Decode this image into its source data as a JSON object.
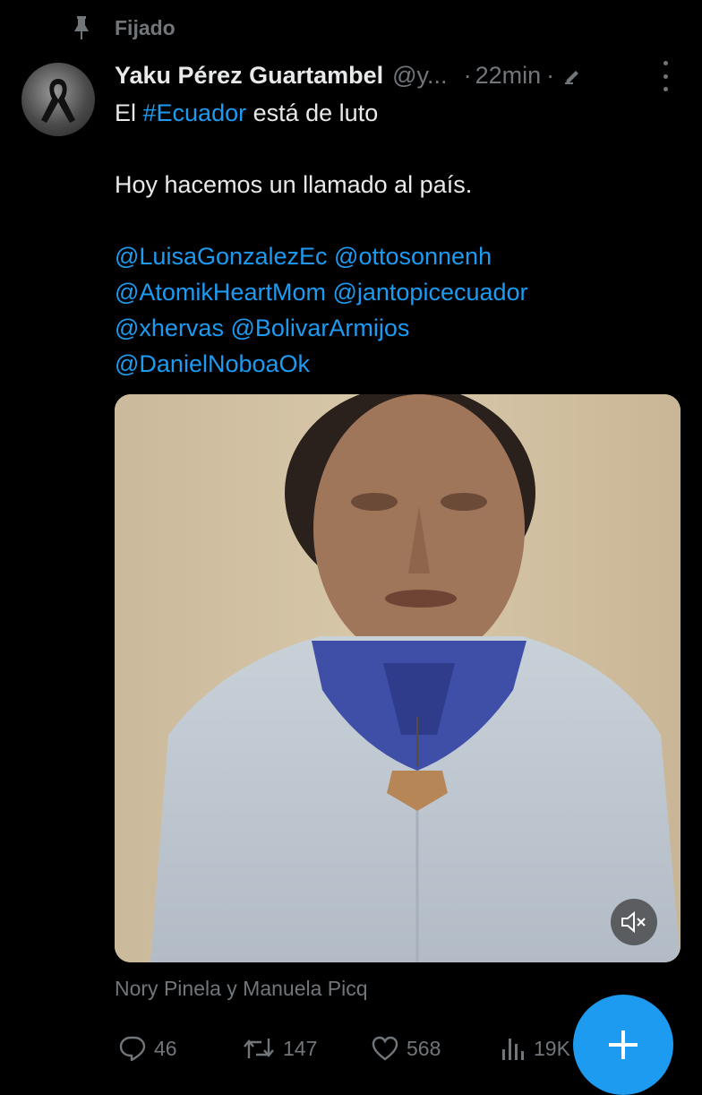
{
  "pinned": {
    "label": "Fijado"
  },
  "tweet": {
    "author_name": "Yaku Pérez Guartambel",
    "handle": "@y...",
    "separator": "·",
    "time": "22min",
    "separator2": "·",
    "text_line1_prefix": "El ",
    "text_line1_hashtag": "#Ecuador",
    "text_line1_suffix": " está de luto",
    "text_line2": "Hoy hacemos un llamado al país.",
    "mentions": [
      [
        "@LuisaGonzalezEc",
        "@ottosonnenh"
      ],
      [
        "@AtomikHeartMom",
        "@jantopicecuador"
      ],
      [
        "@xhervas",
        "@BolivarArmijos"
      ],
      [
        "@DanielNoboaOk"
      ]
    ],
    "media_caption": "Nory Pinela y Manuela Picq"
  },
  "actions": {
    "replies": "46",
    "retweets": "147",
    "likes": "568",
    "views": "19K"
  },
  "colors": {
    "background": "#000000",
    "text": "#e7e9ea",
    "muted": "#71767b",
    "accent": "#1d9bf0"
  },
  "icons": [
    "pin-icon",
    "avatar-ribbon-icon",
    "edit-icon",
    "more-icon",
    "mute-icon",
    "reply-icon",
    "retweet-icon",
    "like-icon",
    "views-icon",
    "plus-icon"
  ]
}
